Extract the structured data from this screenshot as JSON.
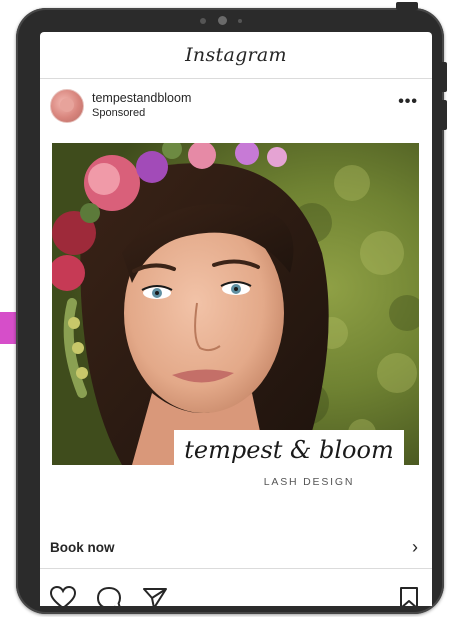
{
  "app": {
    "title": "Instagram"
  },
  "post": {
    "username": "tempestandbloom",
    "sponsored_label": "Sponsored",
    "more_label": "•••",
    "brand_script": "tempest & bloom",
    "brand_sub": "LASH DESIGN",
    "cta_label": "Book now",
    "cta_chevron": "›"
  },
  "colors": {
    "arrow": "#d64ec9",
    "device": "#2b2b2b",
    "text": "#262626",
    "divider": "#dbdbdb"
  },
  "icons": {
    "heart": "heart-icon",
    "comment": "comment-icon",
    "share": "share-icon",
    "bookmark": "bookmark-icon",
    "more": "more-icon",
    "chevron": "chevron-right-icon"
  }
}
